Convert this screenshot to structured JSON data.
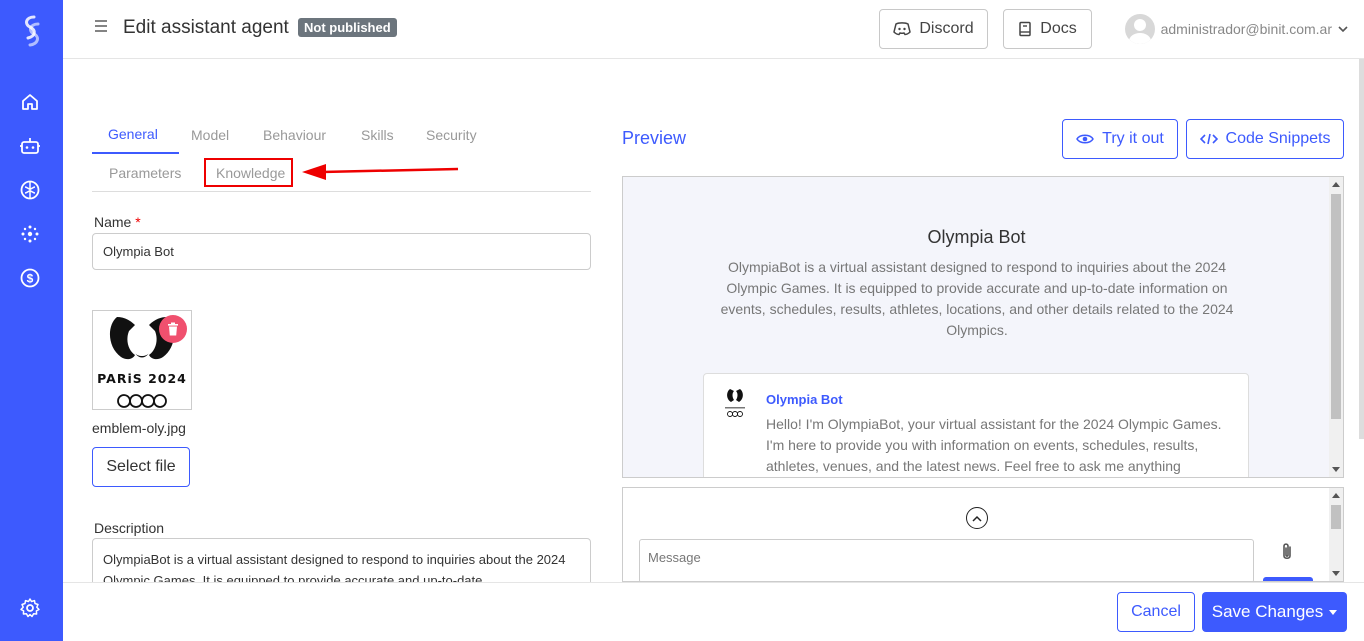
{
  "header": {
    "title": "Edit assistant agent",
    "status_badge": "Not published",
    "discord_label": "Discord",
    "docs_label": "Docs",
    "user_email": "administrador@binit.com.ar"
  },
  "sidebar": {
    "items": [
      {
        "icon": "home-icon"
      },
      {
        "icon": "robot-icon"
      },
      {
        "icon": "brain-icon"
      },
      {
        "icon": "network-icon"
      },
      {
        "icon": "dollar-icon"
      },
      {
        "icon": "gear-icon"
      }
    ]
  },
  "tabs": {
    "row1": [
      "General",
      "Model",
      "Behaviour",
      "Skills",
      "Security"
    ],
    "row2": [
      "Parameters",
      "Knowledge"
    ],
    "active": "General"
  },
  "form": {
    "name_label": "Name",
    "name_required": "*",
    "name_value": "Olympia Bot",
    "image_filename": "emblem-oly.jpg",
    "emblem_text": "PARiS 2024",
    "select_file_label": "Select file",
    "description_label": "Description",
    "description_value": "OlympiaBot is a virtual assistant designed to respond to inquiries about the 2024 Olympic Games. It is equipped to provide accurate and up-to-date"
  },
  "preview": {
    "title": "Preview",
    "try_label": "Try it out",
    "snippets_label": "Code Snippets",
    "bot_name": "Olympia Bot",
    "bot_description": "OlympiaBot is a virtual assistant designed to respond to inquiries about the 2024 Olympic Games. It is equipped to provide accurate and up-to-date information on events, schedules, results, athletes, locations, and other details related to the 2024 Olympics.",
    "message_sender": "Olympia Bot",
    "message_text": "Hello! I'm OlympiaBot, your virtual assistant for the 2024 Olympic Games. I'm here to provide you with information on events, schedules, results, athletes, venues, and the latest news. Feel free to ask me anything",
    "message_placeholder": "Message"
  },
  "footer": {
    "cancel_label": "Cancel",
    "save_label": "Save Changes"
  },
  "colors": {
    "brand": "#3d5afe",
    "badge": "#6c757d",
    "delete": "#f0506e",
    "highlight": "#e00000"
  }
}
